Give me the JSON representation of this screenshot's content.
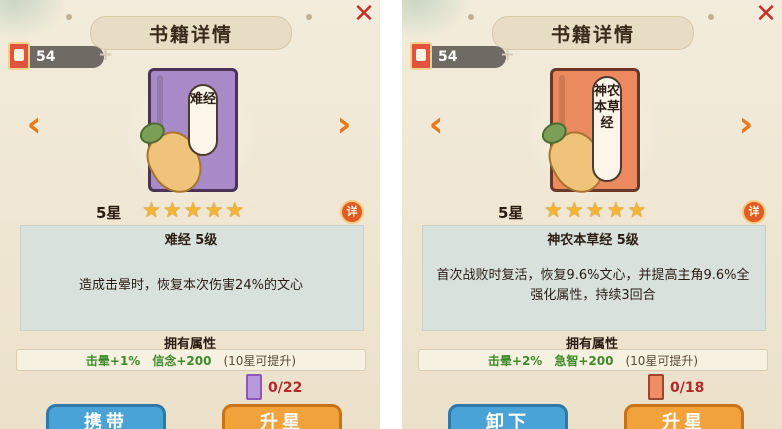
{
  "panels": [
    {
      "header": {
        "title": "书籍详情",
        "close_icon": "close-x-icon"
      },
      "resource": {
        "count": "54",
        "plus": "+"
      },
      "nav": {
        "prev": "‹",
        "next": "›"
      },
      "book": {
        "cover_color": "purple",
        "cover_text": "难经"
      },
      "rating": {
        "stars_label": "5星",
        "stars": [
          "★",
          "★",
          "★",
          "★",
          "★"
        ],
        "detail_label": "详"
      },
      "info": {
        "name_level": "难经  5级",
        "description": "造成击晕时，恢复本次伤害24%的文心"
      },
      "attributes": {
        "title": "拥有属性",
        "attr1": "击晕+1%",
        "attr2": "信念+200",
        "note": "(10星可提升)"
      },
      "fragments": {
        "progress": "0/22"
      },
      "buttons": {
        "primary": "携带",
        "secondary": "升星"
      }
    },
    {
      "header": {
        "title": "书籍详情",
        "close_icon": "close-x-icon"
      },
      "resource": {
        "count": "54",
        "plus": "+"
      },
      "nav": {
        "prev": "‹",
        "next": "›"
      },
      "book": {
        "cover_color": "orange",
        "cover_text": "神农本草经"
      },
      "rating": {
        "stars_label": "5星",
        "stars": [
          "★",
          "★",
          "★",
          "★",
          "★"
        ],
        "detail_label": "详"
      },
      "info": {
        "name_level": "神农本草经  5级",
        "description": "首次战败时复活，恢复9.6%文心，并提高主角9.6%全强化属性，持续3回合"
      },
      "attributes": {
        "title": "拥有属性",
        "attr1": "击晕+2%",
        "attr2": "急智+200",
        "note": "(10星可提升)"
      },
      "fragments": {
        "progress": "0/18"
      },
      "buttons": {
        "primary": "卸下",
        "secondary": "升星"
      }
    }
  ],
  "colors": {
    "accent_orange": "#e67a1c",
    "close_red": "#c4332a",
    "attr_green": "#3f8a2a",
    "fragment_red": "#b02a2a"
  }
}
